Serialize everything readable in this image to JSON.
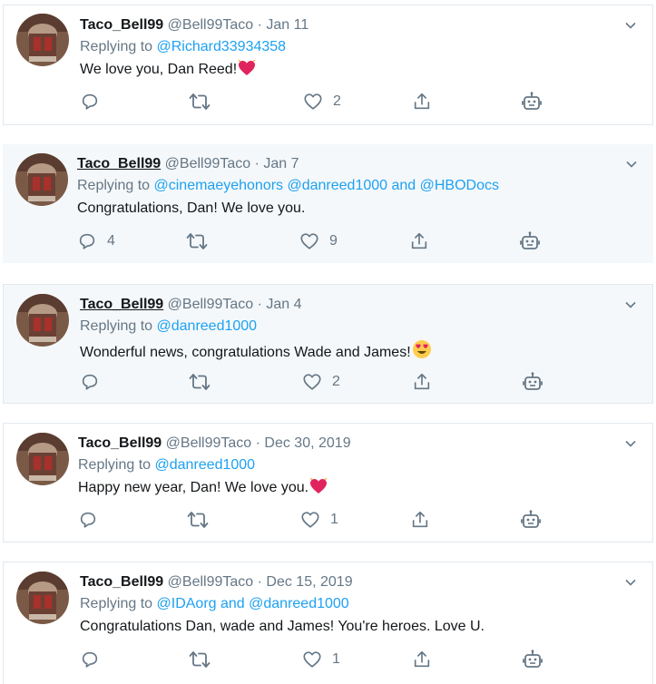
{
  "tweets": [
    {
      "name": "Taco_Bell99",
      "handle": "@Bell99Taco",
      "separator": "·",
      "date": "Jan 11",
      "reply_prefix": "Replying to",
      "reply_targets": "@Richard33934358",
      "text": "We love you, Dan Reed!",
      "emoji": "heart-emoji",
      "reply_count": "",
      "retweet_count": "",
      "like_count": "2"
    },
    {
      "name": "Taco_Bell99",
      "handle": "@Bell99Taco",
      "separator": "·",
      "date": "Jan 7",
      "reply_prefix": "Replying to",
      "reply_targets": "@cinemaeyehonors @danreed1000 and @HBODocs",
      "text": "Congratulations, Dan! We love you.",
      "emoji": "",
      "reply_count": "4",
      "retweet_count": "",
      "like_count": "9"
    },
    {
      "name": "Taco_Bell99",
      "handle": "@Bell99Taco",
      "separator": "·",
      "date": "Jan 4",
      "reply_prefix": "Replying to",
      "reply_targets": "@danreed1000",
      "text": "Wonderful news, congratulations Wade and James!",
      "emoji": "heart-eyes-emoji",
      "reply_count": "",
      "retweet_count": "",
      "like_count": "2"
    },
    {
      "name": "Taco_Bell99",
      "handle": "@Bell99Taco",
      "separator": "·",
      "date": "Dec 30, 2019",
      "reply_prefix": "Replying to",
      "reply_targets": "@danreed1000",
      "text": "Happy new year, Dan! We love you.",
      "emoji": "heart-emoji",
      "reply_count": "",
      "retweet_count": "",
      "like_count": "1"
    },
    {
      "name": "Taco_Bell99",
      "handle": "@Bell99Taco",
      "separator": "·",
      "date": "Dec 15, 2019",
      "reply_prefix": "Replying to",
      "reply_targets": "@IDAorg and @danreed1000",
      "text": "Congratulations Dan, wade and James! You're heroes. Love U.",
      "emoji": "",
      "reply_count": "",
      "retweet_count": "",
      "like_count": "1"
    }
  ],
  "colors": {
    "accent": "#1da1f2",
    "secondary_text": "#657786",
    "primary_text": "#14171a",
    "border": "#e1e8ed",
    "highlight_bg": "#f5f8fa",
    "heart": "#e0245e"
  },
  "icons": [
    "chevron-down-icon",
    "reply-icon",
    "retweet-icon",
    "like-icon",
    "share-icon",
    "analytics-robot-icon"
  ]
}
